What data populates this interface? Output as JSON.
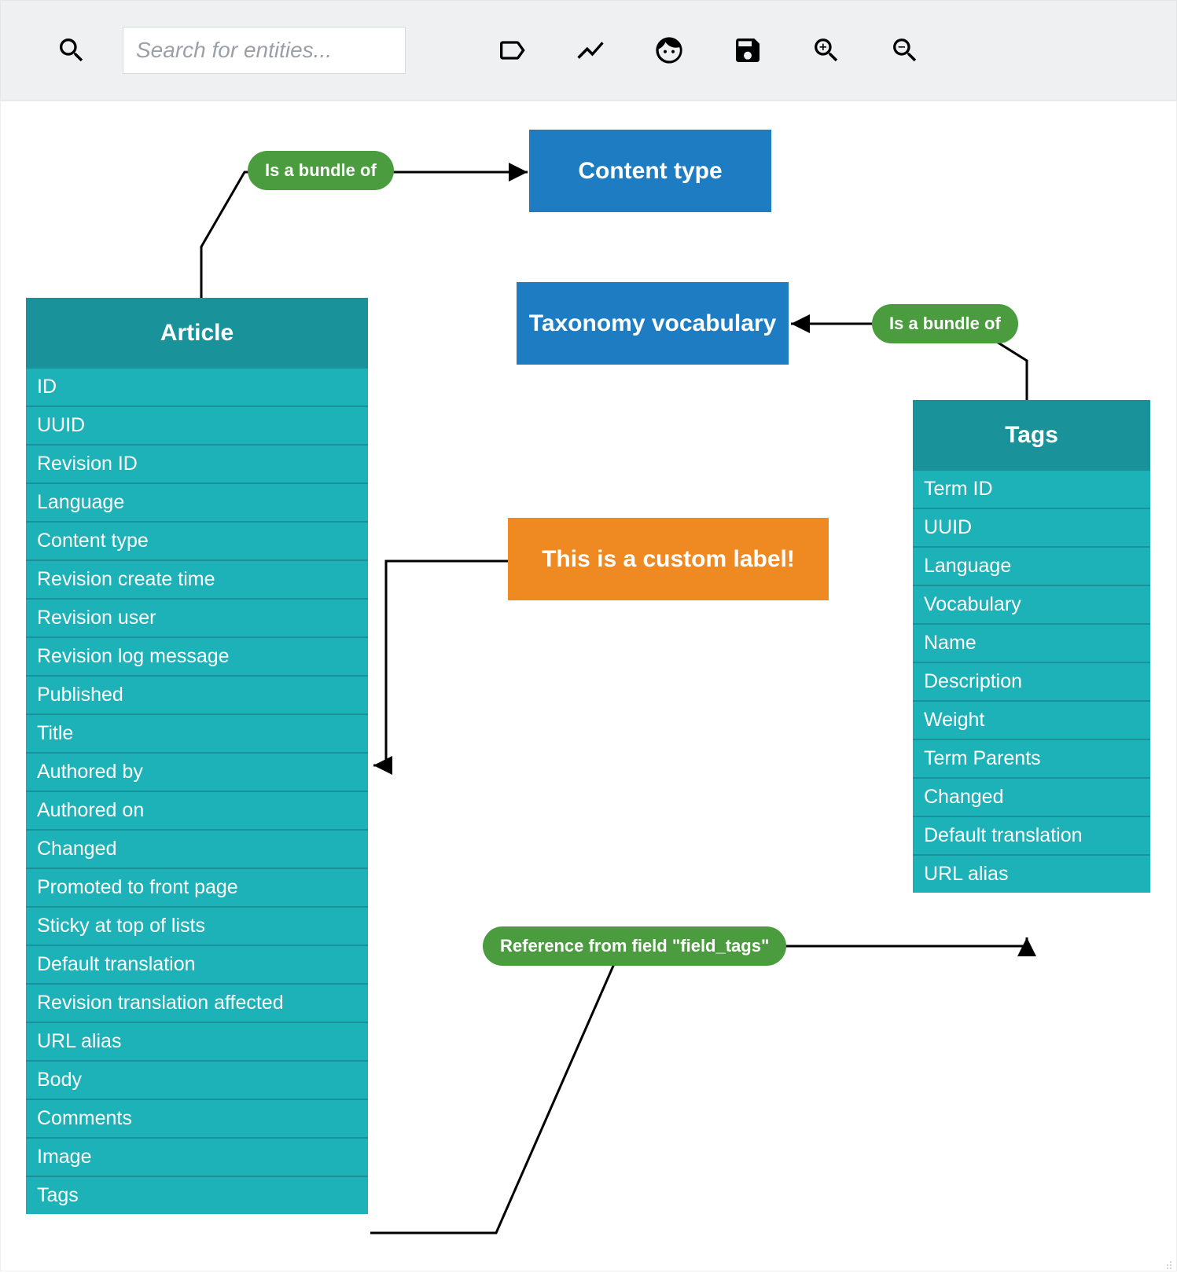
{
  "toolbar": {
    "search_placeholder": "Search for entities..."
  },
  "nodes": {
    "content_type": {
      "label": "Content type"
    },
    "taxonomy_vocabulary": {
      "label": "Taxonomy vocabulary"
    },
    "custom_label": "This is a custom label!"
  },
  "edges": {
    "article_bundle": "Is a bundle of",
    "tags_bundle": "Is a bundle of",
    "field_tags_ref": "Reference from field \"field_tags\""
  },
  "entities": {
    "article": {
      "title": "Article",
      "fields": [
        "ID",
        "UUID",
        "Revision ID",
        "Language",
        "Content type",
        "Revision create time",
        "Revision user",
        "Revision log message",
        "Published",
        "Title",
        "Authored by",
        "Authored on",
        "Changed",
        "Promoted to front page",
        "Sticky at top of lists",
        "Default translation",
        "Revision translation affected",
        "URL alias",
        "Body",
        "Comments",
        "Image",
        "Tags"
      ]
    },
    "tags": {
      "title": "Tags",
      "fields": [
        "Term ID",
        "UUID",
        "Language",
        "Vocabulary",
        "Name",
        "Description",
        "Weight",
        "Term Parents",
        "Changed",
        "Default translation",
        "URL alias"
      ]
    }
  },
  "colors": {
    "entity_header": "#1a9299",
    "entity_row": "#1db1b8",
    "type_node": "#1e7dc2",
    "edge_label": "#4a9c3f",
    "custom_label": "#ef8a22"
  }
}
